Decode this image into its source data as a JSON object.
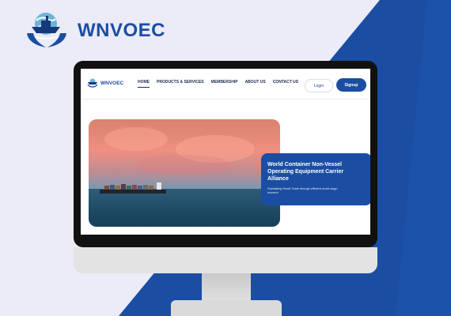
{
  "brand": {
    "name": "WNVOEC",
    "logo_icon": "ship-globe-hands-logo",
    "color": "#1b4ea3"
  },
  "site": {
    "logo_text": "WNVOEC",
    "nav": [
      {
        "label": "HOME",
        "active": true
      },
      {
        "label": "PRODUCTS & SERVICES",
        "active": false
      },
      {
        "label": "MEMBERSHIP",
        "active": false
      },
      {
        "label": "ABOUT US",
        "active": false
      },
      {
        "label": "CONTACT US",
        "active": false
      }
    ],
    "login_label": "Login",
    "signup_label": "Signup",
    "hero": {
      "title": "World Container Non-Vessel Operating Equipment Carrier Alliance",
      "subtitle": "Facilitating World Trade through efficient world cargo moment"
    }
  },
  "colors": {
    "accent": "#1b4ea3",
    "background": "#ecebf8",
    "monitor_frame": "#111111"
  }
}
